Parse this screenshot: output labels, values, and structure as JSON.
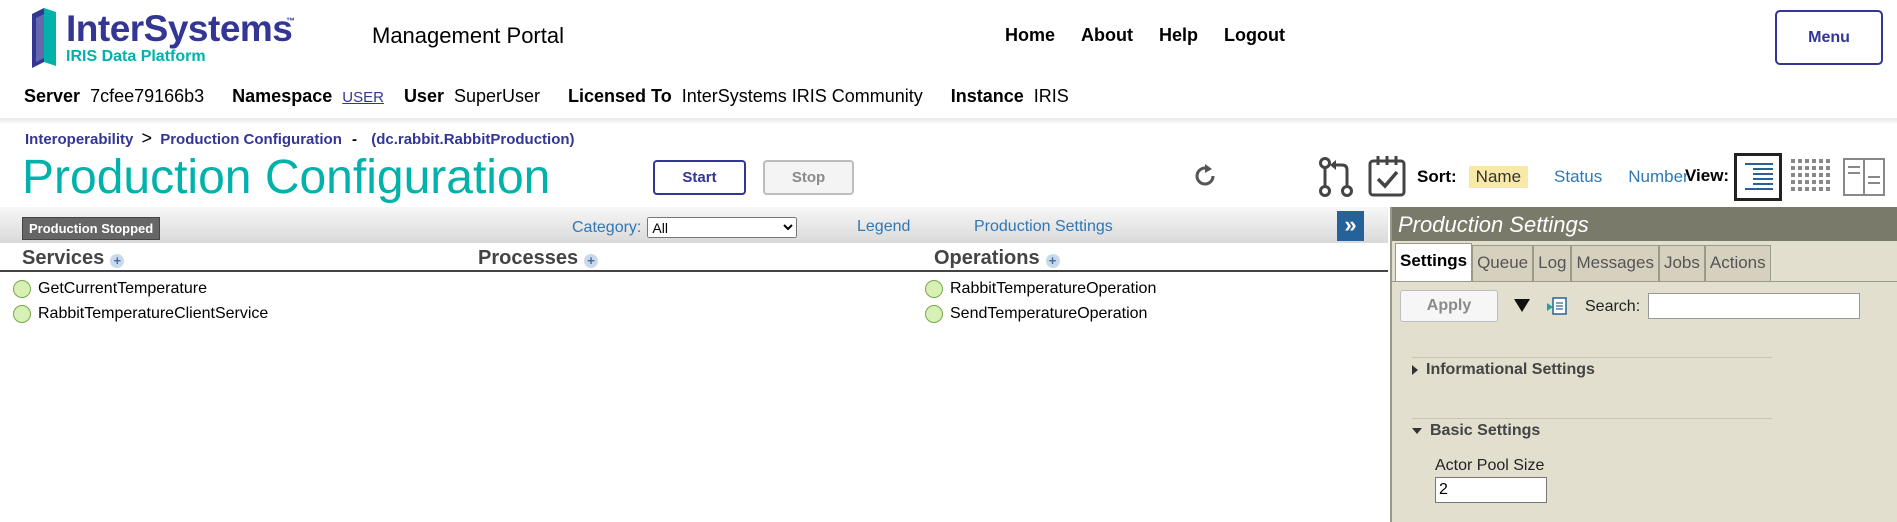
{
  "header": {
    "logo_text": "InterSystems",
    "logo_tm": "™",
    "logo_sub": "IRIS Data Platform",
    "portal_title": "Management Portal",
    "nav": [
      "Home",
      "About",
      "Help",
      "Logout"
    ],
    "menu_label": "Menu"
  },
  "info": {
    "server_label": "Server",
    "server_value": "7cfee79166b3",
    "namespace_label": "Namespace",
    "namespace_value": "USER",
    "user_label": "User",
    "user_value": "SuperUser",
    "licensed_label": "Licensed To",
    "licensed_value": "InterSystems IRIS Community",
    "instance_label": "Instance",
    "instance_value": "IRIS"
  },
  "breadcrumb": {
    "items": [
      "Interoperability",
      "Production Configuration"
    ],
    "separator": ">",
    "dash": "-",
    "production_name": "(dc.rabbit.RabbitProduction)"
  },
  "page_title": "Production Configuration",
  "actions": {
    "start": "Start",
    "stop": "Stop"
  },
  "sort": {
    "label": "Sort:",
    "options": [
      "Name",
      "Status",
      "Number"
    ],
    "active": "Name"
  },
  "view": {
    "label": "View:"
  },
  "toolbar": {
    "status_badge": "Production Stopped",
    "category_label": "Category:",
    "category_value": "All",
    "legend": "Legend",
    "production_settings": "Production Settings",
    "expand": "»"
  },
  "columns": {
    "services": "Services",
    "processes": "Processes",
    "operations": "Operations"
  },
  "services": [
    "GetCurrentTemperature",
    "RabbitTemperatureClientService"
  ],
  "operations": [
    "RabbitTemperatureOperation",
    "SendTemperatureOperation"
  ],
  "settings_panel": {
    "title": "Production Settings",
    "tabs": [
      "Settings",
      "Queue",
      "Log",
      "Messages",
      "Jobs",
      "Actions"
    ],
    "active_tab": "Settings",
    "apply": "Apply",
    "search_label": "Search:",
    "search_value": "",
    "sections": [
      "Informational Settings",
      "Basic Settings"
    ],
    "actor_pool_label": "Actor Pool Size",
    "actor_pool_value": "2"
  },
  "colors": {
    "brand": "#333695",
    "teal": "#00b2a9",
    "link": "#2f77b6",
    "panel_title_bg": "#7a7a6a",
    "panel_bg": "#e2dfcf",
    "status_dot": "#d6f0b5",
    "sort_active_bg": "#f9e9a6"
  }
}
